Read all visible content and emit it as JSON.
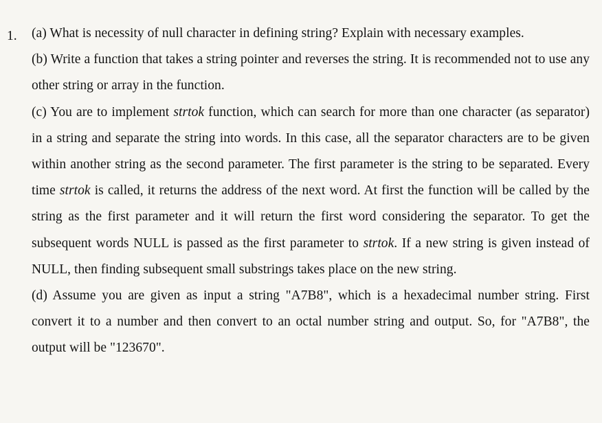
{
  "question": {
    "number": "1.",
    "parts": [
      {
        "id": "a",
        "segments": [
          {
            "text": "(a) What is necessity of null character in defining string? Explain with necessary examples.",
            "italic": false
          }
        ]
      },
      {
        "id": "b",
        "segments": [
          {
            "text": "(b) Write a function that takes a string pointer and reverses the string. It is recommended not to use any other string or array in the function.",
            "italic": false
          }
        ]
      },
      {
        "id": "c",
        "segments": [
          {
            "text": "(c) You are to implement ",
            "italic": false
          },
          {
            "text": "strtok",
            "italic": true
          },
          {
            "text": " function, which can search for more than one character (as separator) in a string and separate the string into words. In this case, all the separator characters are to be given within another string as the second parameter. The first parameter is the string to be separated. Every time ",
            "italic": false
          },
          {
            "text": "strtok",
            "italic": true
          },
          {
            "text": " is called, it returns the address of the next word. At first the function will be called by the string as the first parameter and it will return the first word considering the separator. To get the subsequent words NULL is passed as the first parameter to ",
            "italic": false
          },
          {
            "text": "strtok",
            "italic": true
          },
          {
            "text": ". If a new string is given instead of NULL, then finding subsequent small substrings takes place on the new string.",
            "italic": false
          }
        ]
      },
      {
        "id": "d",
        "segments": [
          {
            "text": "(d) Assume you are given as input a string \"A7B8\", which is a hexadecimal number string. First convert it to a number and then convert to an octal number string and output. So, for \"A7B8\", the output will be \"123670\".",
            "italic": false
          }
        ]
      }
    ]
  }
}
